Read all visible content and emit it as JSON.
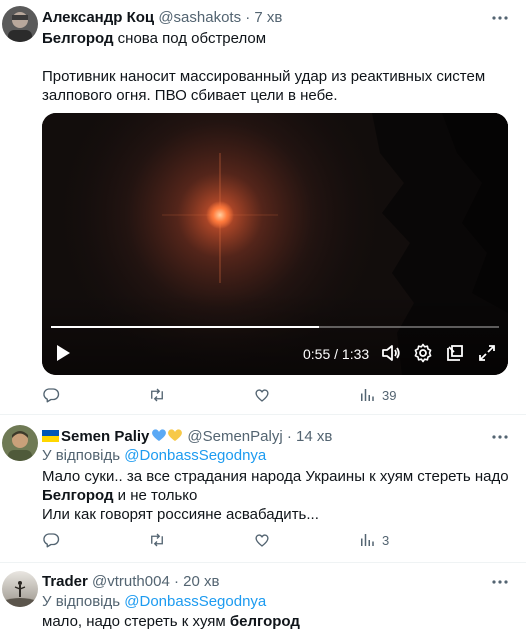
{
  "tweets": [
    {
      "author_name": "Александр Коц",
      "handle": "@sashakots",
      "sep": "·",
      "time": "7 хв",
      "text_bold": "Белгород",
      "text_rest": " снова под обстрелом",
      "paragraph_line1": "Противник наносит массированный удар из реактивных систем",
      "paragraph_line2": "залпового огня. ПВО сбивает цели в небе.",
      "video": {
        "time": "0:55 / 1:33",
        "progress": 0.598
      },
      "views": "39"
    },
    {
      "author_name": "Semen Paliy",
      "name_emoji_flag": "ukraine-flag",
      "name_hearts": "blue-yellow-hearts",
      "handle": "@SemenPalyj",
      "sep": "·",
      "time": "14 хв",
      "reply_prefix": "У відповідь",
      "reply_handle": "@DonbassSegodnya",
      "line1": "Мало суки.. за все страдания народа Украины к хуям стереть надо",
      "line2_bold": "Белгород",
      "line2_rest": " и не только",
      "line3": "Или как говорят россияне асвабадить...",
      "views": "3"
    },
    {
      "author_name": "Trader",
      "handle": "@vtruth004",
      "sep": "·",
      "time": "20 хв",
      "reply_prefix": "У відповідь",
      "reply_handle": "@DonbassSegodnya",
      "line1_rest": "мало, надо стереть к хуям ",
      "line1_bold": "белгород"
    }
  ],
  "colors": {
    "text": "#0f1419",
    "secondary": "#536471",
    "link": "#1d9bf0",
    "divider": "#eff3f4"
  }
}
